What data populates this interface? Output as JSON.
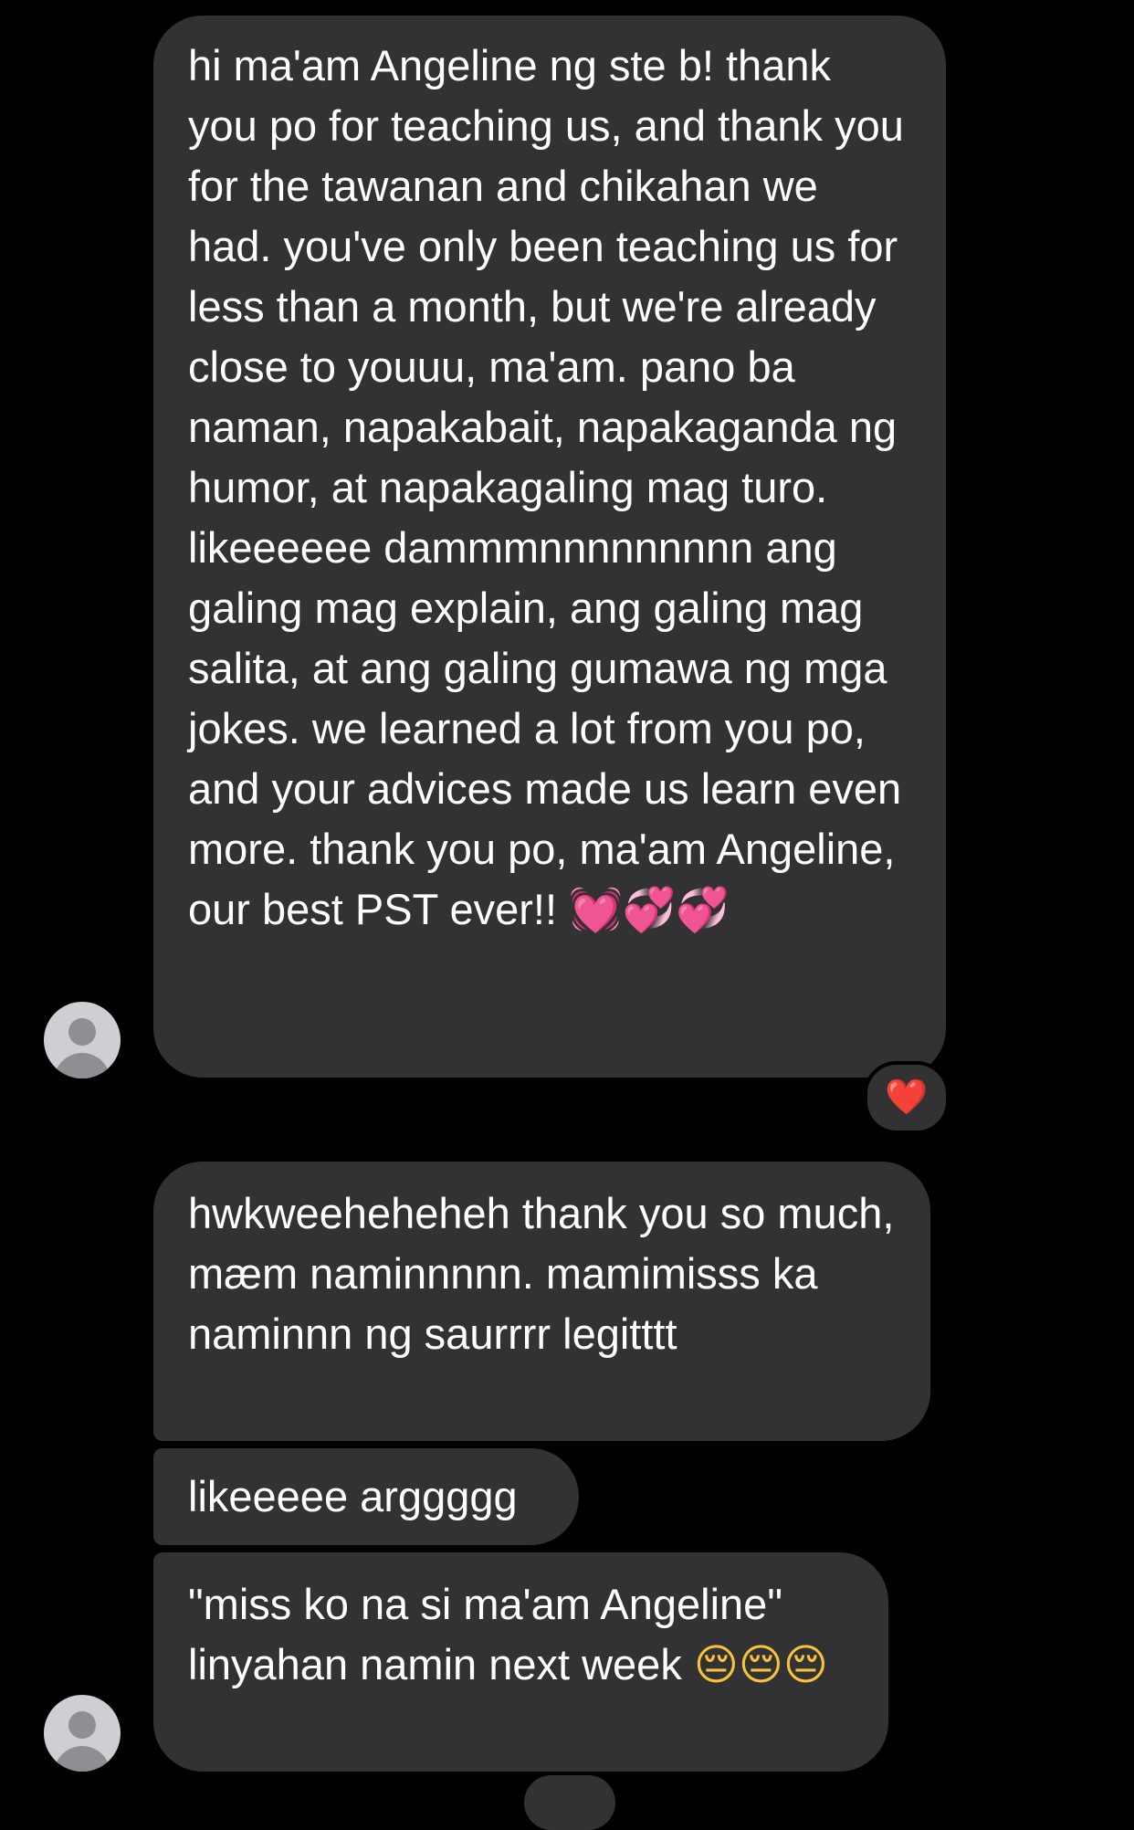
{
  "conversation": {
    "messages": [
      {
        "text": "hi ma'am Angeline ng ste b! thank you po for teaching us, and thank you for the tawanan and chikahan we had. you've only been teaching us for less than a month, but we're already close to youuu, ma'am. pano ba naman, napakabait, napakaganda ng humor, at napakagaling mag turo. likeeeeee dammmnnnnnnnnn ang galing mag explain, ang galing mag salita, at ang galing gumawa ng mga jokes. we learned a lot from you po, and your advices made us learn even more. thank you po, ma'am Angeline, our best PST ever!!",
        "emoji_suffix": "💓💞💞",
        "reaction": "❤️"
      },
      {
        "text": "hwkweeheheheh thank you so much, mæm naminnnnn. mamimisss ka naminnn ng saurrrr legitttt"
      },
      {
        "text": "likeeeee arggggg"
      },
      {
        "text": "\"miss ko na si ma'am Angeline\" linyahan namin next week",
        "emoji_suffix": "😔😔😔"
      }
    ]
  },
  "colors": {
    "background": "#000000",
    "bubble": "#323234",
    "text": "#ffffff",
    "avatar_bg": "#cfcfd3",
    "avatar_fg": "#8e8e93"
  },
  "icons": {
    "avatar": "person-placeholder-icon",
    "reaction": "red-heart-icon"
  }
}
